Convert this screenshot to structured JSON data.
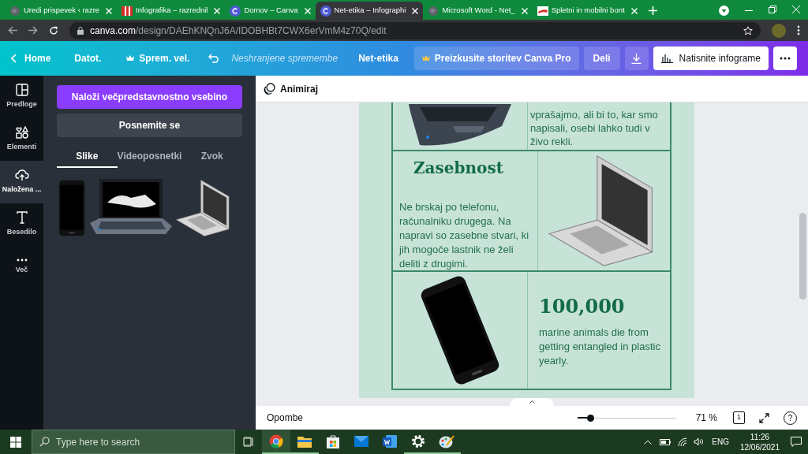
{
  "browser": {
    "tabs": [
      {
        "title": "Uredi prispevek ‹ razre",
        "selected": false
      },
      {
        "title": "Infografika – razrednil",
        "selected": false
      },
      {
        "title": "Domov – Canva",
        "selected": false
      },
      {
        "title": "Net-etika – Infographi",
        "selected": true
      },
      {
        "title": "Microsoft Word - Net_",
        "selected": false
      },
      {
        "title": "Spletni in mobilni bont",
        "selected": false
      }
    ],
    "url_host": "canva.com",
    "url_path": "/design/DAEhKNQnJ6A/IDOBHBt7CWX6erVmM4z70Q/edit"
  },
  "toolbar": {
    "home": "Home",
    "file": "Datot.",
    "resize": "Sprem. vel.",
    "status": "Neshranjene spremembe",
    "title": "Net-etika",
    "pro": "Preizkusite storitev Canva Pro",
    "share": "Deli",
    "print": "Natisnite infograme"
  },
  "rail": [
    {
      "label": "Predloge",
      "selected": false
    },
    {
      "label": "Elementi",
      "selected": false
    },
    {
      "label": "Naložena ...",
      "selected": true
    },
    {
      "label": "Besedilo",
      "selected": false
    },
    {
      "label": "Več",
      "selected": false
    }
  ],
  "panel": {
    "upload": "Naloži večpredstavnostno vsebino",
    "record": "Posnemite se",
    "tabs": [
      {
        "label": "Slike",
        "selected": true
      },
      {
        "label": "Videoposnetki",
        "selected": false
      },
      {
        "label": "Zvok",
        "selected": false
      }
    ]
  },
  "editor": {
    "animate": "Animiraj",
    "rows": [
      {
        "text": "vprašajmo, ali bi to, kar smo napisali, osebi lahko tudi v živo rekli."
      },
      {
        "heading": "Zasebnost",
        "text": "Ne brskaj po telefonu, računalniku drugega. Na napravi so zasebne stvari, ki jih mogoče lastnik ne želi deliti z drugimi."
      },
      {
        "heading": "100,000",
        "text": "marine animals die from getting entangled in plastic yearly."
      }
    ]
  },
  "footer": {
    "notes": "Opombe",
    "zoom": {
      "level": 0.13
    },
    "zoom_text": "71 %",
    "page": "1",
    "help": "?"
  },
  "taskbar": {
    "search": {
      "placeholder": "Type here to search"
    },
    "apps": [
      {
        "running": true
      },
      {
        "running": true
      },
      {
        "running": false
      },
      {
        "running": false
      },
      {
        "running": false
      },
      {
        "running": true
      },
      {
        "running": true
      }
    ],
    "language": "ENG",
    "time": "11:26",
    "date": "12/06/2021"
  }
}
